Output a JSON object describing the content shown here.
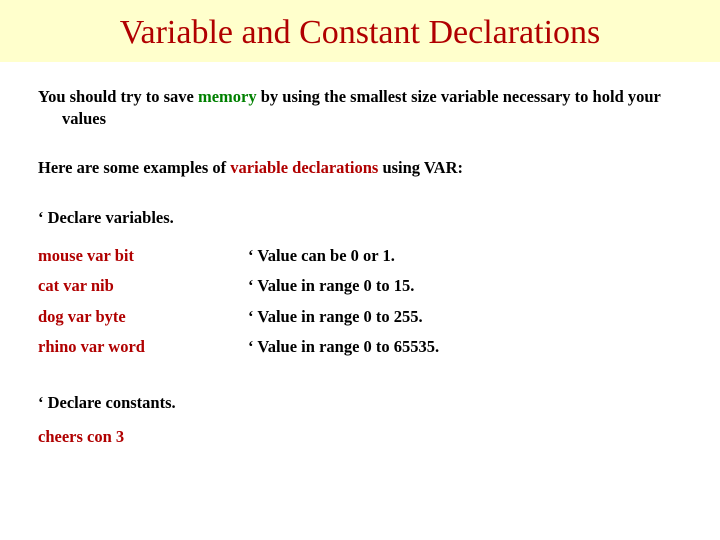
{
  "title": "Variable and Constant Declarations",
  "intro": {
    "prefix": "You should try to save ",
    "memory": "memory",
    "suffix": " by using the smallest size variable necessary to hold your values"
  },
  "examples_line": {
    "prefix": "Here are some examples of ",
    "highlight": "variable declarations",
    "suffix": " using VAR:"
  },
  "decl_vars_heading": "‘ Declare variables.",
  "rows": [
    {
      "code": "mouse var bit",
      "comment": " ‘ Value can be 0 or 1."
    },
    {
      "code": "cat var nib",
      "comment": "‘ Value in range 0 to 15."
    },
    {
      "code": "dog var byte",
      "comment": " ‘ Value in range 0 to 255."
    },
    {
      "code": "rhino var word",
      "comment": " ‘ Value in range 0 to 65535."
    }
  ],
  "decl_const_heading": "‘ Declare constants.",
  "const_code": "cheers con  3",
  "colors": {
    "accent": "#b00000",
    "title_bg": "#ffffcc"
  }
}
